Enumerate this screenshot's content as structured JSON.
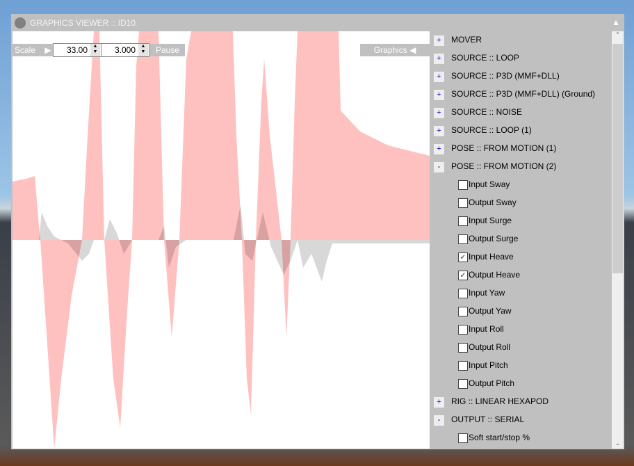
{
  "window": {
    "title": "GRAPHICS VIEWER :: ID10",
    "collapse_icon": "triangle-up"
  },
  "toolbar": {
    "scale_label": "Scale",
    "play_icon": "▶",
    "value1": "33.00",
    "value2": "3.000",
    "pause_label": "Pause",
    "graphics_label": "Graphics",
    "graphics_icon": "◀"
  },
  "panel": {
    "items": [
      {
        "type": "group",
        "sign": "+",
        "label": "MOVER"
      },
      {
        "type": "group",
        "sign": "+",
        "label": "SOURCE :: LOOP"
      },
      {
        "type": "group",
        "sign": "+",
        "label": "SOURCE :: P3D (MMF+DLL)"
      },
      {
        "type": "group",
        "sign": "+",
        "label": "SOURCE :: P3D (MMF+DLL) (Ground)"
      },
      {
        "type": "group",
        "sign": "+",
        "label": "SOURCE :: NOISE"
      },
      {
        "type": "group",
        "sign": "+",
        "label": "SOURCE :: LOOP (1)"
      },
      {
        "type": "group",
        "sign": "+",
        "label": "POSE :: FROM MOTION (1)"
      },
      {
        "type": "group",
        "sign": "-",
        "label": "POSE :: FROM MOTION (2)"
      },
      {
        "type": "check",
        "checked": false,
        "label": "Input Sway"
      },
      {
        "type": "check",
        "checked": false,
        "label": "Output Sway"
      },
      {
        "type": "check",
        "checked": false,
        "label": "Input Surge"
      },
      {
        "type": "check",
        "checked": false,
        "label": "Output Surge"
      },
      {
        "type": "check",
        "checked": true,
        "label": "Input Heave"
      },
      {
        "type": "check",
        "checked": true,
        "label": "Output Heave"
      },
      {
        "type": "check",
        "checked": false,
        "label": "Input Yaw"
      },
      {
        "type": "check",
        "checked": false,
        "label": "Output Yaw"
      },
      {
        "type": "check",
        "checked": false,
        "label": "Input Roll"
      },
      {
        "type": "check",
        "checked": false,
        "label": "Output Roll"
      },
      {
        "type": "check",
        "checked": false,
        "label": "Input Pitch"
      },
      {
        "type": "check",
        "checked": false,
        "label": "Output Pitch"
      },
      {
        "type": "group",
        "sign": "+",
        "label": "RIG :: LINEAR HEXAPOD"
      },
      {
        "type": "group",
        "sign": "-",
        "label": "OUTPUT :: SERIAL"
      },
      {
        "type": "check",
        "checked": false,
        "label": "Soft start/stop %"
      }
    ]
  },
  "chart_data": {
    "type": "area",
    "xlim": [
      0,
      600
    ],
    "ylim": [
      -300,
      300
    ],
    "series": [
      {
        "name": "Input Heave",
        "color": "#ffc0c0",
        "points": [
          [
            0,
            84
          ],
          [
            20,
            88
          ],
          [
            32,
            92
          ],
          [
            38,
            20
          ],
          [
            40,
            0
          ],
          [
            50,
            -150
          ],
          [
            60,
            -300
          ],
          [
            70,
            -200
          ],
          [
            85,
            -80
          ],
          [
            100,
            0
          ],
          [
            108,
            150
          ],
          [
            117,
            300
          ],
          [
            125,
            300
          ],
          [
            132,
            0
          ],
          [
            145,
            -200
          ],
          [
            155,
            -270
          ],
          [
            165,
            -100
          ],
          [
            172,
            0
          ],
          [
            178,
            250
          ],
          [
            182,
            300
          ],
          [
            210,
            300
          ],
          [
            218,
            0
          ],
          [
            229,
            -140
          ],
          [
            240,
            0
          ],
          [
            250,
            260
          ],
          [
            257,
            300
          ],
          [
            317,
            300
          ],
          [
            322,
            150
          ],
          [
            330,
            0
          ],
          [
            337,
            -200
          ],
          [
            343,
            -250
          ],
          [
            350,
            0
          ],
          [
            358,
            200
          ],
          [
            362,
            260
          ],
          [
            370,
            150
          ],
          [
            387,
            0
          ],
          [
            394,
            -140
          ],
          [
            400,
            0
          ],
          [
            406,
            200
          ],
          [
            410,
            300
          ],
          [
            469,
            300
          ],
          [
            472,
            186
          ],
          [
            500,
            156
          ],
          [
            540,
            136
          ],
          [
            600,
            121
          ]
        ]
      },
      {
        "name": "Output Heave",
        "color": "#c8c8c8",
        "points": [
          [
            0,
            0
          ],
          [
            38,
            0
          ],
          [
            42,
            40
          ],
          [
            50,
            20
          ],
          [
            60,
            5
          ],
          [
            80,
            -5
          ],
          [
            100,
            -30
          ],
          [
            110,
            -20
          ],
          [
            117,
            0
          ],
          [
            132,
            0
          ],
          [
            140,
            30
          ],
          [
            150,
            10
          ],
          [
            160,
            -20
          ],
          [
            172,
            0
          ],
          [
            210,
            0
          ],
          [
            218,
            20
          ],
          [
            225,
            -40
          ],
          [
            235,
            -10
          ],
          [
            250,
            0
          ],
          [
            318,
            0
          ],
          [
            328,
            50
          ],
          [
            335,
            -20
          ],
          [
            345,
            -30
          ],
          [
            360,
            40
          ],
          [
            372,
            -10
          ],
          [
            390,
            -50
          ],
          [
            400,
            -30
          ],
          [
            410,
            0
          ],
          [
            418,
            -40
          ],
          [
            430,
            -20
          ],
          [
            445,
            -60
          ],
          [
            452,
            -30
          ],
          [
            460,
            -5
          ],
          [
            600,
            -5
          ]
        ]
      }
    ]
  }
}
